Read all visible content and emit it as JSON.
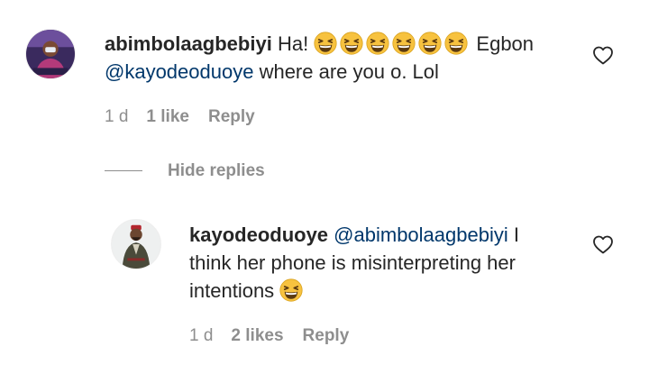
{
  "comment": {
    "username": "abimbolaagbebiyi",
    "text_before": " Ha! ",
    "emojis": [
      "grinning-squinting-face",
      "grinning-squinting-face",
      "grinning-squinting-face",
      "grinning-squinting-face",
      "grinning-squinting-face",
      "grinning-squinting-face"
    ],
    "text_after": " Egbon",
    "mention": "@kayodeoduoye",
    "text_end": " where are you o. Lol",
    "time": "1 d",
    "likes": "1 like",
    "reply_label": "Reply"
  },
  "hide_replies_label": "Hide replies",
  "reply": {
    "username": "kayodeoduoye",
    "mention": "@abimbolaagbebiyi",
    "text_a": " I",
    "text_b": "think her phone is misinterpreting her",
    "text_c": "intentions ",
    "emoji": "grinning-squinting-face",
    "time": "1 d",
    "likes": "2 likes",
    "reply_label": "Reply"
  },
  "colors": {
    "text": "#262626",
    "muted": "#8e8e8e",
    "mention": "#00376b",
    "emoji_face": "#f7c23f"
  }
}
